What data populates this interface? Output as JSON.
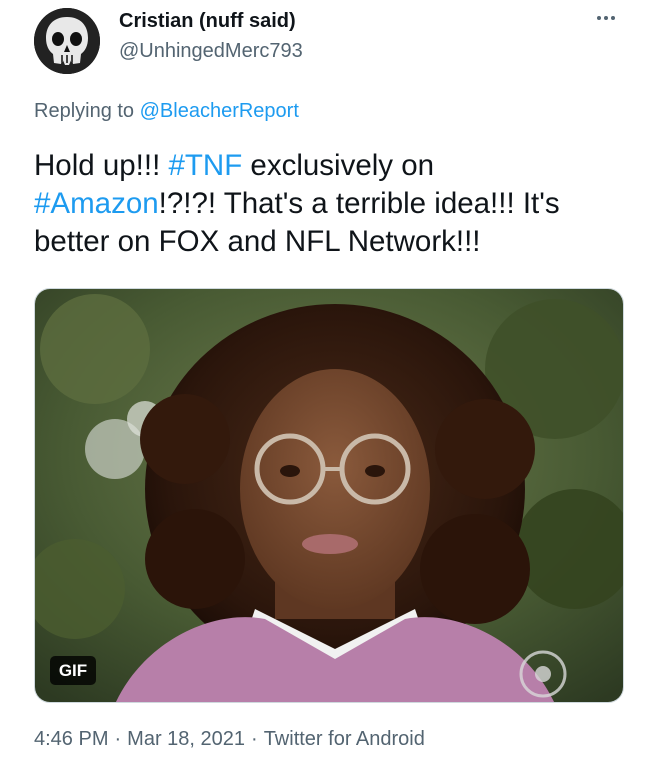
{
  "user": {
    "display_name": "Cristian (nuff said)",
    "handle": "@UnhingedMerc793",
    "avatar_icon": "skull-icon"
  },
  "reply": {
    "prefix": "Replying to ",
    "mention": "@BleacherReport"
  },
  "tweet": {
    "text_part1": "Hold up!!! ",
    "hashtag1": "#TNF",
    "text_part2": " exclusively on ",
    "hashtag2": "#Amazon",
    "text_part3": "!?!?! That's a terrible idea!!! It's better on FOX and NFL Network!!!"
  },
  "media": {
    "badge": "GIF"
  },
  "footer": {
    "time": "4:46 PM",
    "date": "Mar 18, 2021",
    "source": "Twitter for Android",
    "separator": "·"
  },
  "colors": {
    "link": "#1d9bf0",
    "secondary": "#536471",
    "primary_text": "#0f1419"
  }
}
